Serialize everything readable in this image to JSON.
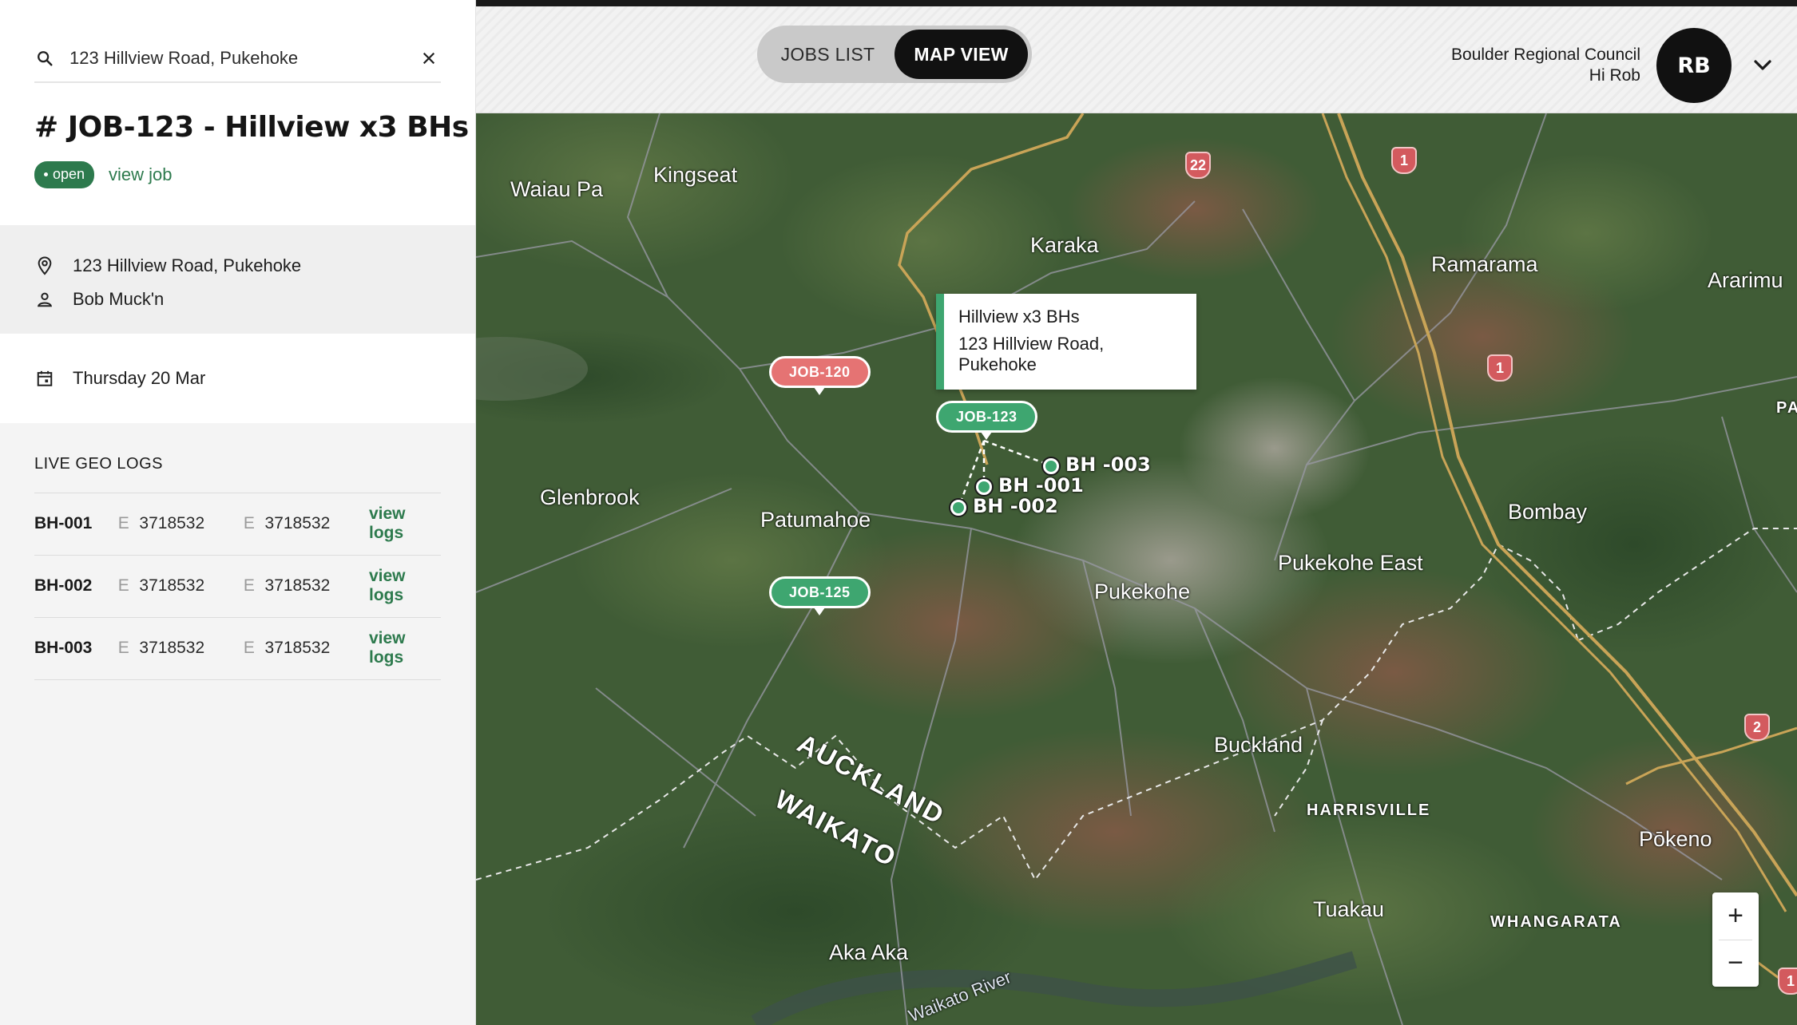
{
  "search": {
    "value": "123 Hillview Road, Pukehoke"
  },
  "job": {
    "title": "# JOB-123 - Hillview x3 BHs",
    "status": "open",
    "view_link": "view job",
    "address": "123 Hillview Road, Pukehoke",
    "contact": "Bob Muck'n",
    "date": "Thursday 20 Mar"
  },
  "geo_logs": {
    "title": "LIVE GEO LOGS",
    "rows": [
      {
        "id": "BH-001",
        "e1_label": "E",
        "e1": "3718532",
        "e2_label": "E",
        "e2": "3718532",
        "link": "view logs"
      },
      {
        "id": "BH-002",
        "e1_label": "E",
        "e1": "3718532",
        "e2_label": "E",
        "e2": "3718532",
        "link": "view logs"
      },
      {
        "id": "BH-003",
        "e1_label": "E",
        "e1": "3718532",
        "e2_label": "E",
        "e2": "3718532",
        "link": "view logs"
      }
    ]
  },
  "header": {
    "toggle": {
      "jobs_list": "JOBS LIST",
      "map_view": "MAP VIEW",
      "active": "map_view"
    },
    "user": {
      "org": "Boulder Regional Council",
      "greeting": "Hi Rob",
      "initials": "RB"
    }
  },
  "map": {
    "places": {
      "waiau_pa": "Waiau Pa",
      "kingseat": "Kingseat",
      "karaka": "Karaka",
      "ramarama": "Ramarama",
      "ararimu": "Ararimu",
      "pa": "PA",
      "glenbrook": "Glenbrook",
      "patumahoe": "Patumahoe",
      "bombay": "Bombay",
      "pukekohe_east": "Pukekohe East",
      "pukekohe": "Pukekohe",
      "auckland": "AUCKLAND",
      "waikato": "WAIKATO",
      "buckland": "Buckland",
      "harrisville": "HARRISVILLE",
      "tuakau": "Tuakau",
      "whangarata": "WHANGARATA",
      "pokeno": "Pōkeno",
      "aka_aka": "Aka Aka",
      "waikato_river": "Waikato River"
    },
    "shields": {
      "s22": "22",
      "s1a": "1",
      "s1b": "1",
      "s2": "2",
      "s1c": "1"
    },
    "pins": {
      "job120": "JOB-120",
      "job123": "JOB-123",
      "job125": "JOB-125"
    },
    "popup": {
      "title": "Hillview x3 BHs",
      "address": "123 Hillview Road, Pukehoke"
    },
    "boreholes": {
      "bh001": "BH -001",
      "bh002": "BH -002",
      "bh003": "BH -003"
    },
    "zoom_in": "+",
    "zoom_out": "−"
  }
}
